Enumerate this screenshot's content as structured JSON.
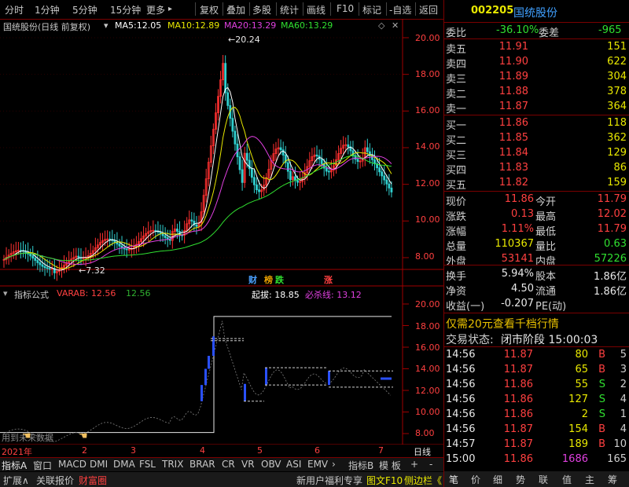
{
  "toolbar": {
    "left_items": [
      "分时",
      "1分钟",
      "5分钟",
      "15分钟",
      "更多"
    ],
    "more_arrow": "▸",
    "right_items": [
      "复权",
      "叠加",
      "多股",
      "统计",
      "画线",
      "F10",
      "标记",
      "-自选",
      "返回"
    ]
  },
  "stock": {
    "code": "002205",
    "name": "国统股份"
  },
  "main_panel": {
    "title": "国统股份(日线 前复权)",
    "diamond": "◇",
    "ma": [
      {
        "label": "MA5:",
        "value": "12.05",
        "color": "#ffffff"
      },
      {
        "label": "MA10:",
        "value": "12.89",
        "color": "#e8e800"
      },
      {
        "label": "MA20:",
        "value": "13.29",
        "color": "#e040e0"
      },
      {
        "label": "MA60:",
        "value": "13.29",
        "color": "#30e030"
      }
    ],
    "right_icons": [
      "◇",
      "✕"
    ],
    "high_label": "20.24",
    "low_label": "7.32",
    "y_ticks": [
      "20.00",
      "18.00",
      "16.00",
      "14.00",
      "12.00",
      "10.00",
      "8.00"
    ],
    "tags": [
      {
        "text": "财",
        "color": "#4aa0ff"
      },
      {
        "text": "榜",
        "color": "#e8a000"
      },
      {
        "text": "跌",
        "color": "#30e030"
      },
      {
        "text": "涨",
        "color": "#ff4040"
      }
    ]
  },
  "indicator_panel": {
    "title": "指标公式",
    "varab_label": "VARAB:",
    "varab_value1": "12.56",
    "varab_value2": "12.56",
    "qiba_label": "起拔:",
    "qiba_value": "18.85",
    "bisha_label": "必杀线:",
    "bisha_value": "13.12",
    "y_ticks": [
      "20.00",
      "18.00",
      "16.00",
      "14.00",
      "12.00",
      "10.00",
      "8.00"
    ],
    "hint": "用到未来数据"
  },
  "x_axis": {
    "labels": [
      "2021年",
      "2",
      "3",
      "4",
      "5",
      "6",
      "7"
    ],
    "right_label": "日线"
  },
  "indicator_tabs": [
    "指标A",
    "窗口",
    "MACD",
    "DMI",
    "DMA",
    "FSL",
    "TRIX",
    "BRAR",
    "CR",
    "VR",
    "OBV",
    "ASI",
    "EMV"
  ],
  "indicator_tabs_right": [
    "指标B",
    "模 板",
    "+",
    "-"
  ],
  "bottom_bar": {
    "items": [
      "扩展∧",
      "关联报价",
      "财富圈"
    ],
    "promo": "新用户福利专享",
    "f10": "图文F10",
    "side": "侧边栏《"
  },
  "quote": {
    "weibi_label": "委比",
    "weibi_value": "-36.10%",
    "weicha_label": "委差",
    "weicha_value": "-965",
    "asks": [
      {
        "label": "卖五",
        "price": "11.91",
        "vol": "151"
      },
      {
        "label": "卖四",
        "price": "11.90",
        "vol": "622"
      },
      {
        "label": "卖三",
        "price": "11.89",
        "vol": "304"
      },
      {
        "label": "卖二",
        "price": "11.88",
        "vol": "378"
      },
      {
        "label": "卖一",
        "price": "11.87",
        "vol": "364"
      }
    ],
    "bids": [
      {
        "label": "买一",
        "price": "11.86",
        "vol": "118"
      },
      {
        "label": "买二",
        "price": "11.85",
        "vol": "362"
      },
      {
        "label": "买三",
        "price": "11.84",
        "vol": "129"
      },
      {
        "label": "买四",
        "price": "11.83",
        "vol": "86"
      },
      {
        "label": "买五",
        "price": "11.82",
        "vol": "159"
      }
    ],
    "stats": [
      {
        "l1": "现价",
        "v1": "11.86",
        "c1": "#ff4040",
        "l2": "今开",
        "v2": "11.79",
        "c2": "#ff4040"
      },
      {
        "l1": "涨跌",
        "v1": "0.13",
        "c1": "#ff4040",
        "l2": "最高",
        "v2": "12.02",
        "c2": "#ff4040"
      },
      {
        "l1": "涨幅",
        "v1": "1.11%",
        "c1": "#ff4040",
        "l2": "最低",
        "v2": "11.79",
        "c2": "#ff4040"
      },
      {
        "l1": "总量",
        "v1": "110367",
        "c1": "#e8e800",
        "l2": "量比",
        "v2": "0.63",
        "c2": "#30e030"
      },
      {
        "l1": "外盘",
        "v1": "53141",
        "c1": "#ff4040",
        "l2": "内盘",
        "v2": "57226",
        "c2": "#30e030"
      }
    ],
    "stats2": [
      {
        "l1": "换手",
        "v1": "5.94%",
        "l2": "股本",
        "v2": "1.86亿"
      },
      {
        "l1": "净资",
        "v1": "4.50",
        "l2": "流通",
        "v2": "1.86亿"
      },
      {
        "l1": "收益(一)",
        "v1": "-0.207",
        "l2": "PE(动)",
        "v2": ""
      }
    ],
    "promo_text": "仅需20元查看千档行情",
    "status_label": "交易状态:",
    "status_value": "闭市阶段 15:00:03",
    "ticks": [
      {
        "time": "14:56",
        "price": "11.87",
        "vol": "80",
        "side": "B",
        "n": "5"
      },
      {
        "time": "14:56",
        "price": "11.87",
        "vol": "65",
        "side": "B",
        "n": "3"
      },
      {
        "time": "14:56",
        "price": "11.86",
        "vol": "55",
        "side": "S",
        "n": "2"
      },
      {
        "time": "14:56",
        "price": "11.86",
        "vol": "127",
        "side": "S",
        "n": "4"
      },
      {
        "time": "14:56",
        "price": "11.86",
        "vol": "2",
        "side": "S",
        "n": "1"
      },
      {
        "time": "14:56",
        "price": "11.87",
        "vol": "154",
        "side": "B",
        "n": "4"
      },
      {
        "time": "14:57",
        "price": "11.87",
        "vol": "189",
        "side": "B",
        "n": "10"
      },
      {
        "time": "15:00",
        "price": "11.86",
        "vol": "1686",
        "side": "",
        "n": "165"
      }
    ],
    "tabs": [
      "笔",
      "价",
      "细",
      "势",
      "联",
      "值",
      "主",
      "筹"
    ]
  }
}
